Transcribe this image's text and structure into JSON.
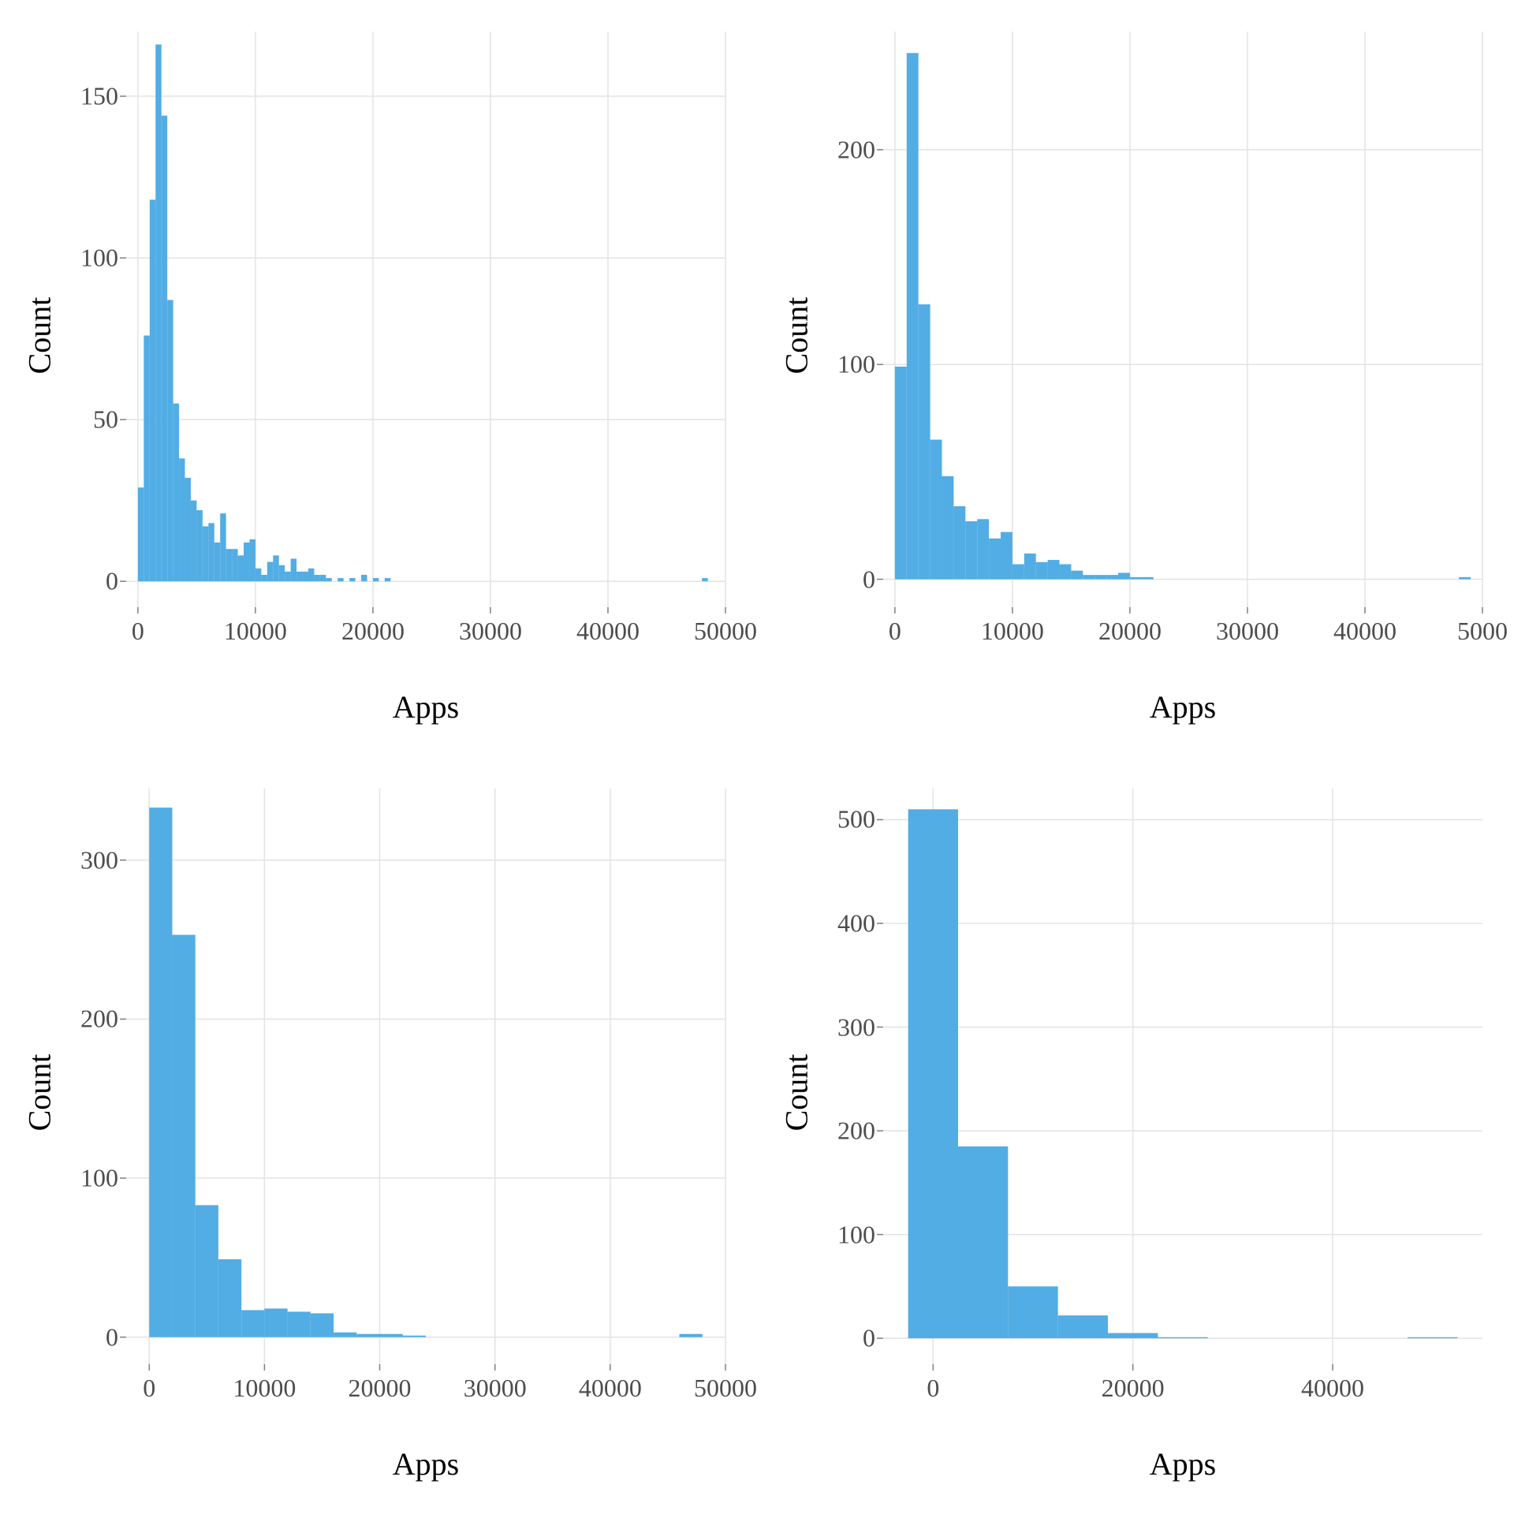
{
  "chart_data": [
    {
      "type": "histogram",
      "xlabel": "Apps",
      "ylabel": "Count",
      "xlim": [
        -1000,
        50000
      ],
      "ylim": [
        -8,
        170
      ],
      "x_ticks": [
        0,
        10000,
        20000,
        30000,
        40000,
        50000
      ],
      "y_ticks": [
        0,
        50,
        100,
        150
      ],
      "bin_width": 500,
      "bins": [
        {
          "x": 0,
          "count": 29
        },
        {
          "x": 500,
          "count": 76
        },
        {
          "x": 1000,
          "count": 118
        },
        {
          "x": 1500,
          "count": 166
        },
        {
          "x": 2000,
          "count": 144
        },
        {
          "x": 2500,
          "count": 87
        },
        {
          "x": 3000,
          "count": 55
        },
        {
          "x": 3500,
          "count": 38
        },
        {
          "x": 4000,
          "count": 32
        },
        {
          "x": 4500,
          "count": 25
        },
        {
          "x": 5000,
          "count": 22
        },
        {
          "x": 5500,
          "count": 17
        },
        {
          "x": 6000,
          "count": 18
        },
        {
          "x": 6500,
          "count": 12
        },
        {
          "x": 7000,
          "count": 21
        },
        {
          "x": 7500,
          "count": 10
        },
        {
          "x": 8000,
          "count": 10
        },
        {
          "x": 8500,
          "count": 8
        },
        {
          "x": 9000,
          "count": 12
        },
        {
          "x": 9500,
          "count": 13
        },
        {
          "x": 10000,
          "count": 4
        },
        {
          "x": 10500,
          "count": 2
        },
        {
          "x": 11000,
          "count": 6
        },
        {
          "x": 11500,
          "count": 8
        },
        {
          "x": 12000,
          "count": 5
        },
        {
          "x": 12500,
          "count": 3
        },
        {
          "x": 13000,
          "count": 7
        },
        {
          "x": 13500,
          "count": 3
        },
        {
          "x": 14000,
          "count": 3
        },
        {
          "x": 14500,
          "count": 4
        },
        {
          "x": 15000,
          "count": 2
        },
        {
          "x": 15500,
          "count": 2
        },
        {
          "x": 16000,
          "count": 1
        },
        {
          "x": 17000,
          "count": 1
        },
        {
          "x": 18000,
          "count": 1
        },
        {
          "x": 19000,
          "count": 2
        },
        {
          "x": 20000,
          "count": 1
        },
        {
          "x": 21000,
          "count": 1
        },
        {
          "x": 48000,
          "count": 1
        }
      ]
    },
    {
      "type": "histogram",
      "xlabel": "Apps",
      "ylabel": "Count",
      "xlim": [
        -1000,
        50000
      ],
      "ylim": [
        -13,
        255
      ],
      "x_ticks": [
        0,
        10000,
        20000,
        30000,
        40000,
        50000
      ],
      "x_tick_labels": [
        "0",
        "10000",
        "20000",
        "30000",
        "40000",
        "5000"
      ],
      "y_ticks": [
        0,
        100,
        200
      ],
      "bin_width": 1000,
      "bins": [
        {
          "x": 0,
          "count": 99
        },
        {
          "x": 1000,
          "count": 245
        },
        {
          "x": 2000,
          "count": 128
        },
        {
          "x": 3000,
          "count": 65
        },
        {
          "x": 4000,
          "count": 48
        },
        {
          "x": 5000,
          "count": 34
        },
        {
          "x": 6000,
          "count": 27
        },
        {
          "x": 7000,
          "count": 28
        },
        {
          "x": 8000,
          "count": 19
        },
        {
          "x": 9000,
          "count": 22
        },
        {
          "x": 10000,
          "count": 7
        },
        {
          "x": 11000,
          "count": 12
        },
        {
          "x": 12000,
          "count": 8
        },
        {
          "x": 13000,
          "count": 9
        },
        {
          "x": 14000,
          "count": 7
        },
        {
          "x": 15000,
          "count": 4
        },
        {
          "x": 16000,
          "count": 2
        },
        {
          "x": 17000,
          "count": 2
        },
        {
          "x": 18000,
          "count": 2
        },
        {
          "x": 19000,
          "count": 3
        },
        {
          "x": 20000,
          "count": 1
        },
        {
          "x": 21000,
          "count": 1
        },
        {
          "x": 48000,
          "count": 1
        }
      ]
    },
    {
      "type": "histogram",
      "xlabel": "Apps",
      "ylabel": "Count",
      "xlim": [
        -2000,
        50000
      ],
      "ylim": [
        -17,
        345
      ],
      "x_ticks": [
        0,
        10000,
        20000,
        30000,
        40000,
        50000
      ],
      "y_ticks": [
        0,
        100,
        200,
        300
      ],
      "bin_width": 2000,
      "bins": [
        {
          "x": 0,
          "count": 333
        },
        {
          "x": 2000,
          "count": 253
        },
        {
          "x": 4000,
          "count": 83
        },
        {
          "x": 6000,
          "count": 49
        },
        {
          "x": 8000,
          "count": 17
        },
        {
          "x": 10000,
          "count": 18
        },
        {
          "x": 12000,
          "count": 16
        },
        {
          "x": 14000,
          "count": 15
        },
        {
          "x": 16000,
          "count": 3
        },
        {
          "x": 18000,
          "count": 2
        },
        {
          "x": 20000,
          "count": 2
        },
        {
          "x": 22000,
          "count": 1
        },
        {
          "x": 46000,
          "count": 2
        }
      ]
    },
    {
      "type": "histogram",
      "xlabel": "Apps",
      "ylabel": "Count",
      "xlim": [
        -5000,
        55000
      ],
      "ylim": [
        -25,
        530
      ],
      "x_ticks": [
        0,
        20000,
        40000
      ],
      "y_ticks": [
        0,
        100,
        200,
        300,
        400,
        500
      ],
      "bin_width": 5000,
      "bins": [
        {
          "x": -2500,
          "count": 510
        },
        {
          "x": 2500,
          "count": 185
        },
        {
          "x": 7500,
          "count": 50
        },
        {
          "x": 12500,
          "count": 22
        },
        {
          "x": 17500,
          "count": 5
        },
        {
          "x": 22500,
          "count": 1
        },
        {
          "x": 47500,
          "count": 1
        }
      ]
    }
  ],
  "colors": {
    "bar": "#52ade4",
    "grid": "#e3e3e3",
    "tick_text": "#4d4d4d"
  }
}
